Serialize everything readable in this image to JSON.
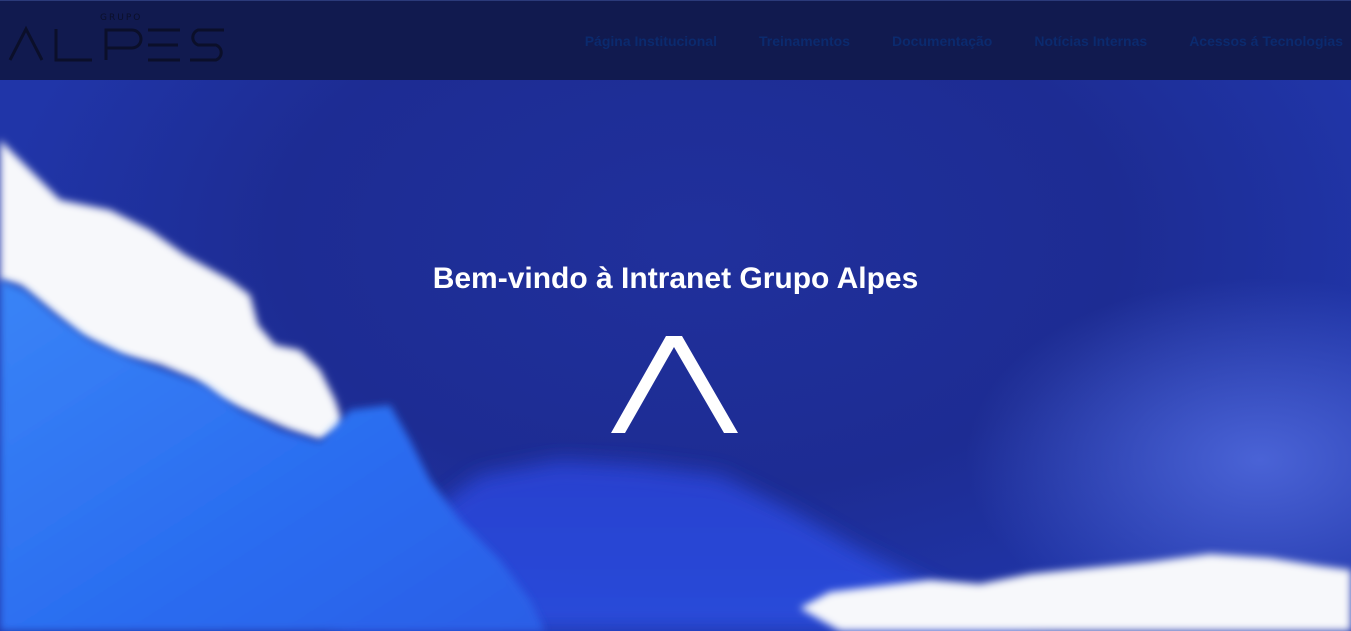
{
  "header": {
    "logo": {
      "small_text": "GRUPO",
      "wordmark": "ALPES"
    },
    "nav": [
      {
        "label": "Página Institucional"
      },
      {
        "label": "Treinamentos"
      },
      {
        "label": "Documentação"
      },
      {
        "label": "Notícias Internas"
      },
      {
        "label": "Acessos á Tecnologias"
      }
    ]
  },
  "hero": {
    "title": "Bem-vindo à Intranet Grupo Alpes",
    "icon": "mountain-peak-icon"
  },
  "colors": {
    "header_bg": "#111a4f",
    "hero_bg": "#1e2f9a",
    "nav_text": "#0b2a6e",
    "light_blue": "#2f6ff0",
    "snow": "#f7f8fb"
  }
}
